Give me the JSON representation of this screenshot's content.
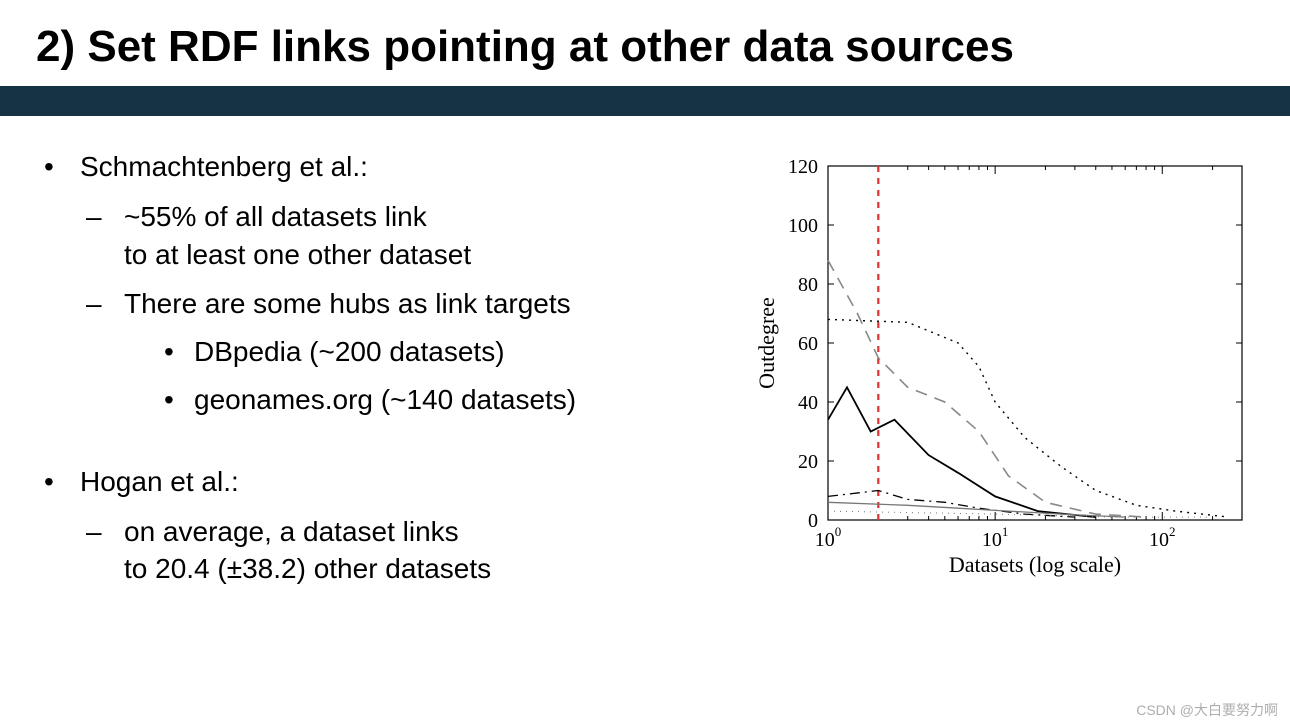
{
  "title": "2) Set RDF links pointing at other data sources",
  "bullets": {
    "b1_lead": "Schmachtenberg et al.:",
    "b1_d1": "~55% of all datasets link\nto at least one other dataset",
    "b1_d2": "There are some hubs as link targets",
    "b1_d2_s1": "DBpedia (~200 datasets)",
    "b1_d2_s2": "geonames.org (~140 datasets)",
    "b2_lead": "Hogan et al.:",
    "b2_d1": "on average, a dataset links\nto 20.4 (±38.2) other datasets"
  },
  "watermark": "CSDN @大白要努力啊",
  "chart_data": {
    "type": "line",
    "xlabel": "Datasets (log scale)",
    "ylabel": "Outdegree",
    "ylim": [
      0,
      120
    ],
    "y_ticks": [
      0,
      20,
      40,
      60,
      80,
      100,
      120
    ],
    "x_ticks": [
      1,
      10,
      100
    ],
    "x_tick_labels": [
      "10⁰",
      "10¹",
      "10²"
    ],
    "x_scale": "log",
    "vline_x": 2,
    "series": [
      {
        "name": "outer-dotted",
        "style": "dotted",
        "points": [
          [
            1,
            68
          ],
          [
            3,
            67
          ],
          [
            6,
            60
          ],
          [
            8,
            52
          ],
          [
            10,
            40
          ],
          [
            15,
            28
          ],
          [
            25,
            18
          ],
          [
            40,
            10
          ],
          [
            70,
            5
          ],
          [
            120,
            3
          ],
          [
            250,
            1
          ]
        ]
      },
      {
        "name": "long-dashed",
        "style": "longdash-gray",
        "points": [
          [
            1,
            88
          ],
          [
            1.5,
            70
          ],
          [
            2,
            55
          ],
          [
            3,
            45
          ],
          [
            5,
            40
          ],
          [
            8,
            30
          ],
          [
            12,
            15
          ],
          [
            20,
            6
          ],
          [
            40,
            2
          ],
          [
            80,
            1
          ]
        ]
      },
      {
        "name": "solid-black",
        "style": "solid",
        "points": [
          [
            1,
            34
          ],
          [
            1.3,
            45
          ],
          [
            1.8,
            30
          ],
          [
            2.5,
            34
          ],
          [
            4,
            22
          ],
          [
            6,
            16
          ],
          [
            10,
            8
          ],
          [
            18,
            3
          ],
          [
            40,
            1
          ]
        ]
      },
      {
        "name": "low-dash",
        "style": "dashdot",
        "points": [
          [
            1,
            8
          ],
          [
            2,
            10
          ],
          [
            3,
            7
          ],
          [
            5,
            6
          ],
          [
            8,
            4
          ],
          [
            15,
            2
          ],
          [
            30,
            1
          ]
        ]
      },
      {
        "name": "low-solid-gray",
        "style": "solid-gray",
        "points": [
          [
            1,
            6
          ],
          [
            3,
            5
          ],
          [
            6,
            4
          ],
          [
            12,
            3
          ],
          [
            25,
            2
          ],
          [
            60,
            1
          ]
        ]
      },
      {
        "name": "tiny-dotted",
        "style": "finedot",
        "points": [
          [
            1,
            3
          ],
          [
            10,
            2
          ],
          [
            50,
            1
          ],
          [
            200,
            1
          ]
        ]
      }
    ]
  }
}
